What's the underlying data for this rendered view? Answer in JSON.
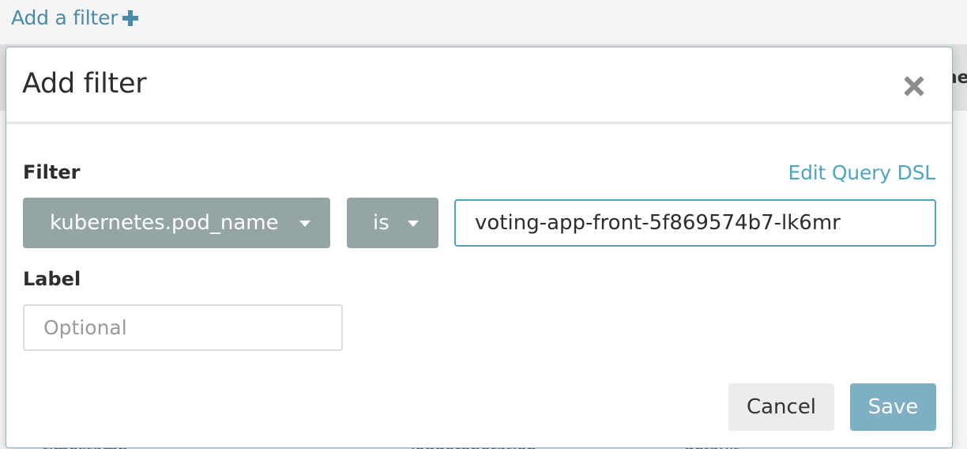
{
  "background": {
    "add_filter_link": "Add a filter",
    "header_fragment": "ne",
    "footer_fragments": [
      "timestamp",
      "loggeroperation",
      "default"
    ]
  },
  "modal": {
    "title": "Add filter",
    "filter_section_label": "Filter",
    "edit_query_dsl": "Edit Query DSL",
    "field_select": {
      "value": "kubernetes.pod_name"
    },
    "operator_select": {
      "value": "is"
    },
    "value_input": {
      "value": "voting-app-front-5f869574b7-lk6mr"
    },
    "label_section_label": "Label",
    "label_input": {
      "placeholder": "Optional",
      "value": ""
    },
    "cancel_label": "Cancel",
    "save_label": "Save"
  },
  "colors": {
    "accent_link": "#4b8aab",
    "edit_dsl_link": "#4ba6c2",
    "select_bg": "#95a5a6",
    "save_bg": "#7fafc4",
    "cancel_bg": "#ececec"
  }
}
